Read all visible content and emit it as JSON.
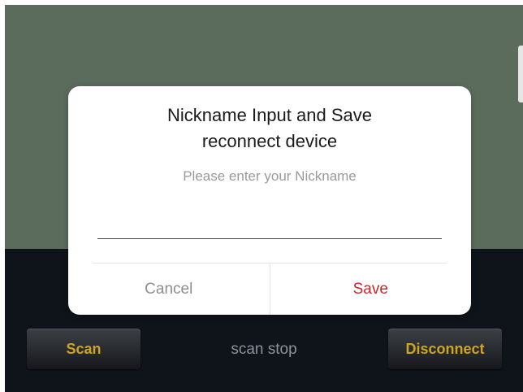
{
  "dialog": {
    "title_line1": "Nickname Input and Save",
    "title_line2": "reconnect device",
    "message": "Please enter your Nickname",
    "input_value": "",
    "cancel_label": "Cancel",
    "save_label": "Save"
  },
  "controls": {
    "scan_label": "Scan",
    "status_text": "scan stop",
    "disconnect_label": "Disconnect"
  },
  "colors": {
    "top_background": "#5b6c5d",
    "bottom_background": "#0f141b",
    "button_text_gold": "#cfa51d",
    "save_red": "#c9262b"
  }
}
